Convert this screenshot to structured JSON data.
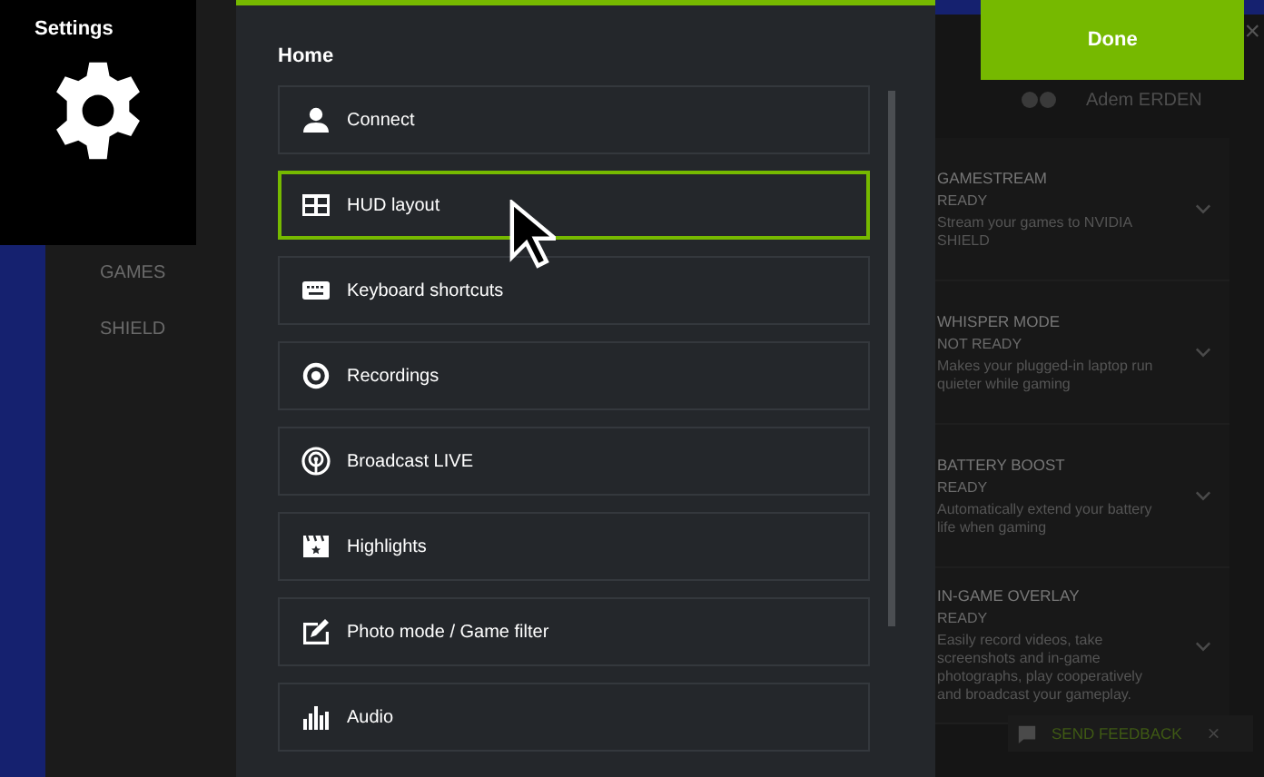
{
  "settings_panel": {
    "title": "Settings"
  },
  "sidebar": {
    "items": [
      {
        "label": "GAMES"
      },
      {
        "label": "SHIELD"
      }
    ]
  },
  "dialog": {
    "heading": "Home",
    "items": [
      {
        "label": "Connect",
        "selected": false
      },
      {
        "label": "HUD layout",
        "selected": true
      },
      {
        "label": "Keyboard shortcuts",
        "selected": false
      },
      {
        "label": "Recordings",
        "selected": false
      },
      {
        "label": "Broadcast LIVE",
        "selected": false
      },
      {
        "label": "Highlights",
        "selected": false
      },
      {
        "label": "Photo mode / Game filter",
        "selected": false
      },
      {
        "label": "Audio",
        "selected": false
      }
    ]
  },
  "done_button": {
    "label": "Done"
  },
  "close_symbol": "×",
  "account": {
    "name": "Adem ERDEN"
  },
  "features": [
    {
      "title": "GAMESTREAM",
      "status": "READY",
      "description": "Stream your games to NVIDIA SHIELD"
    },
    {
      "title": "WHISPER MODE",
      "status": "NOT READY",
      "description": "Makes your plugged-in laptop run quieter while gaming"
    },
    {
      "title": "BATTERY BOOST",
      "status": "READY",
      "description": "Automatically extend your battery life when gaming"
    },
    {
      "title": "IN-GAME OVERLAY",
      "status": "READY",
      "description": "Easily record videos, take screenshots and in-game photographs, play cooperatively and broadcast your gameplay."
    }
  ],
  "feedback": {
    "label": "SEND FEEDBACK",
    "close": "×"
  }
}
